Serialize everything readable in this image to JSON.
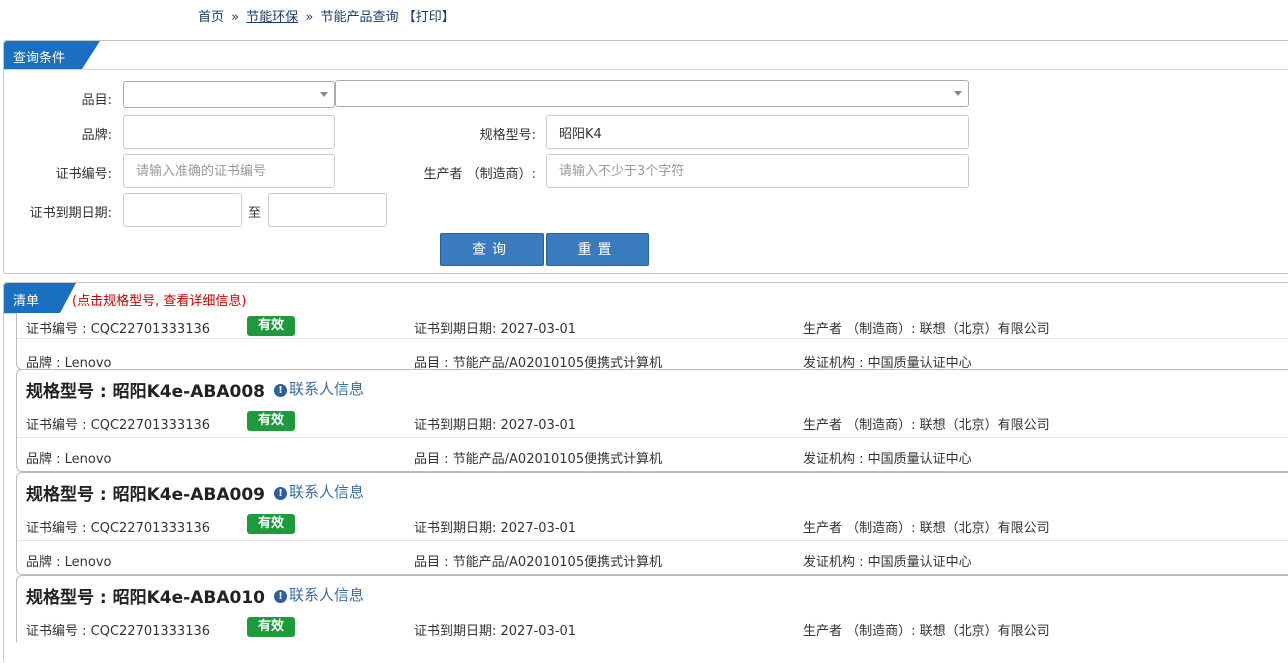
{
  "breadcrumb": {
    "home": "首页",
    "sep": "»",
    "category": "节能环保",
    "current": "节能产品查询",
    "print": "【打印】"
  },
  "search_panel": {
    "title": "查询条件",
    "fields": {
      "category_label": "品目:",
      "brand_label": "品牌:",
      "brand_value": "",
      "model_label": "规格型号:",
      "model_value": "昭阳K4",
      "cert_no_label": "证书编号:",
      "cert_no_placeholder": "请输入准确的证书编号",
      "maker_label": "生产者 （制造商）:",
      "maker_placeholder": "请输入不少于3个字符",
      "expiry_label": "证书到期日期:",
      "expiry_to": "至"
    },
    "buttons": {
      "search": "查询",
      "reset": "重置"
    }
  },
  "list_panel": {
    "title": "清单",
    "hint": "(点击规格型号, 查看详细信息)"
  },
  "colors": {
    "accent": "#1a6fc0",
    "button": "#3a7abf",
    "valid_badge": "#1d9a3c",
    "hint": "#d10000",
    "link": "#3a6ea5"
  },
  "partial_card": {
    "cert_no": "证书编号 : CQC22701333136",
    "badge": "有效",
    "expiry": "证书到期日期: 2027-03-01",
    "maker": "生产者 （制造商）: 联想（北京）有限公司",
    "brand": "品牌 : Lenovo",
    "category": "品目 : 节能产品/A02010105便携式计算机",
    "issuer": "发证机构 : 中国质量认证中心"
  },
  "cards": [
    {
      "title": "规格型号 : 昭阳K4e-ABA008",
      "contact_icon": "info-circle-icon",
      "contact": "联系人信息",
      "cert_no": "证书编号 : CQC22701333136",
      "badge": "有效",
      "expiry": "证书到期日期: 2027-03-01",
      "maker": "生产者 （制造商）: 联想（北京）有限公司",
      "brand": "品牌 : Lenovo",
      "category": "品目 : 节能产品/A02010105便携式计算机",
      "issuer": "发证机构 : 中国质量认证中心"
    },
    {
      "title": "规格型号 : 昭阳K4e-ABA009",
      "contact_icon": "info-circle-icon",
      "contact": "联系人信息",
      "cert_no": "证书编号 : CQC22701333136",
      "badge": "有效",
      "expiry": "证书到期日期: 2027-03-01",
      "maker": "生产者 （制造商）: 联想（北京）有限公司",
      "brand": "品牌 : Lenovo",
      "category": "品目 : 节能产品/A02010105便携式计算机",
      "issuer": "发证机构 : 中国质量认证中心"
    },
    {
      "title": "规格型号 : 昭阳K4e-ABA010",
      "contact_icon": "info-circle-icon",
      "contact": "联系人信息",
      "cert_no": "证书编号 : CQC22701333136",
      "badge": "有效",
      "expiry": "证书到期日期: 2027-03-01",
      "maker": "生产者 （制造商）: 联想（北京）有限公司"
    }
  ]
}
